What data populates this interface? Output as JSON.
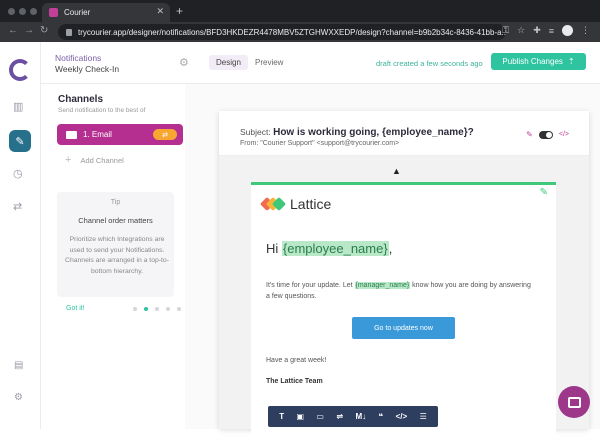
{
  "browser": {
    "tab_title": "Courier",
    "url": "trycourier.app/designer/notifications/BFD3HKDEZR4478MBV5ZTGHWXXEDP/design?channel=b9b2b34c-8436-41bb-a..."
  },
  "header": {
    "title_line1": "Notifications",
    "title_line2": "Weekly Check-In",
    "design_label": "Design",
    "preview_label": "Preview",
    "draft_status": "draft created a few seconds ago",
    "publish_label": "Publish Changes"
  },
  "channels": {
    "title": "Channels",
    "subtitle": "Send notification to the best of",
    "email_label": "1.  Email",
    "add_label": "Add Channel"
  },
  "tip": {
    "heading": "Tip",
    "title": "Channel order matters",
    "body": "Prioritize which Integrations are used to send your Notifications. Channels are arranged in a top-to-bottom hierarchy.",
    "got_it": "Got it!",
    "pages_total": 5,
    "page_current": 2
  },
  "message": {
    "subject_label": "Subject:",
    "subject_value": "How is working going, {employee_name}?",
    "from": "From: \"Courier Support\" <support@trycourier.com>",
    "brand_name": "Lattice",
    "greeting_prefix": "Hi ",
    "greeting_var": "{employee_name}",
    "greeting_suffix": ",",
    "body_before": "It's time for your update. Let ",
    "body_var": "{manager_name}",
    "body_after": " know how you are doing by answering a few questions.",
    "cta_label": "Go to updates now",
    "signoff": "Have a great week!",
    "team": "The Lattice Team"
  },
  "toolbar": [
    "T",
    "▣",
    "▭",
    "⇌",
    "M↓",
    "❝",
    "</>",
    "☰"
  ],
  "colors": {
    "accent": "#b52f90",
    "publish": "#2ec4a0",
    "cta": "#3a9ad9",
    "variable_bg": "#b8e8c8"
  }
}
